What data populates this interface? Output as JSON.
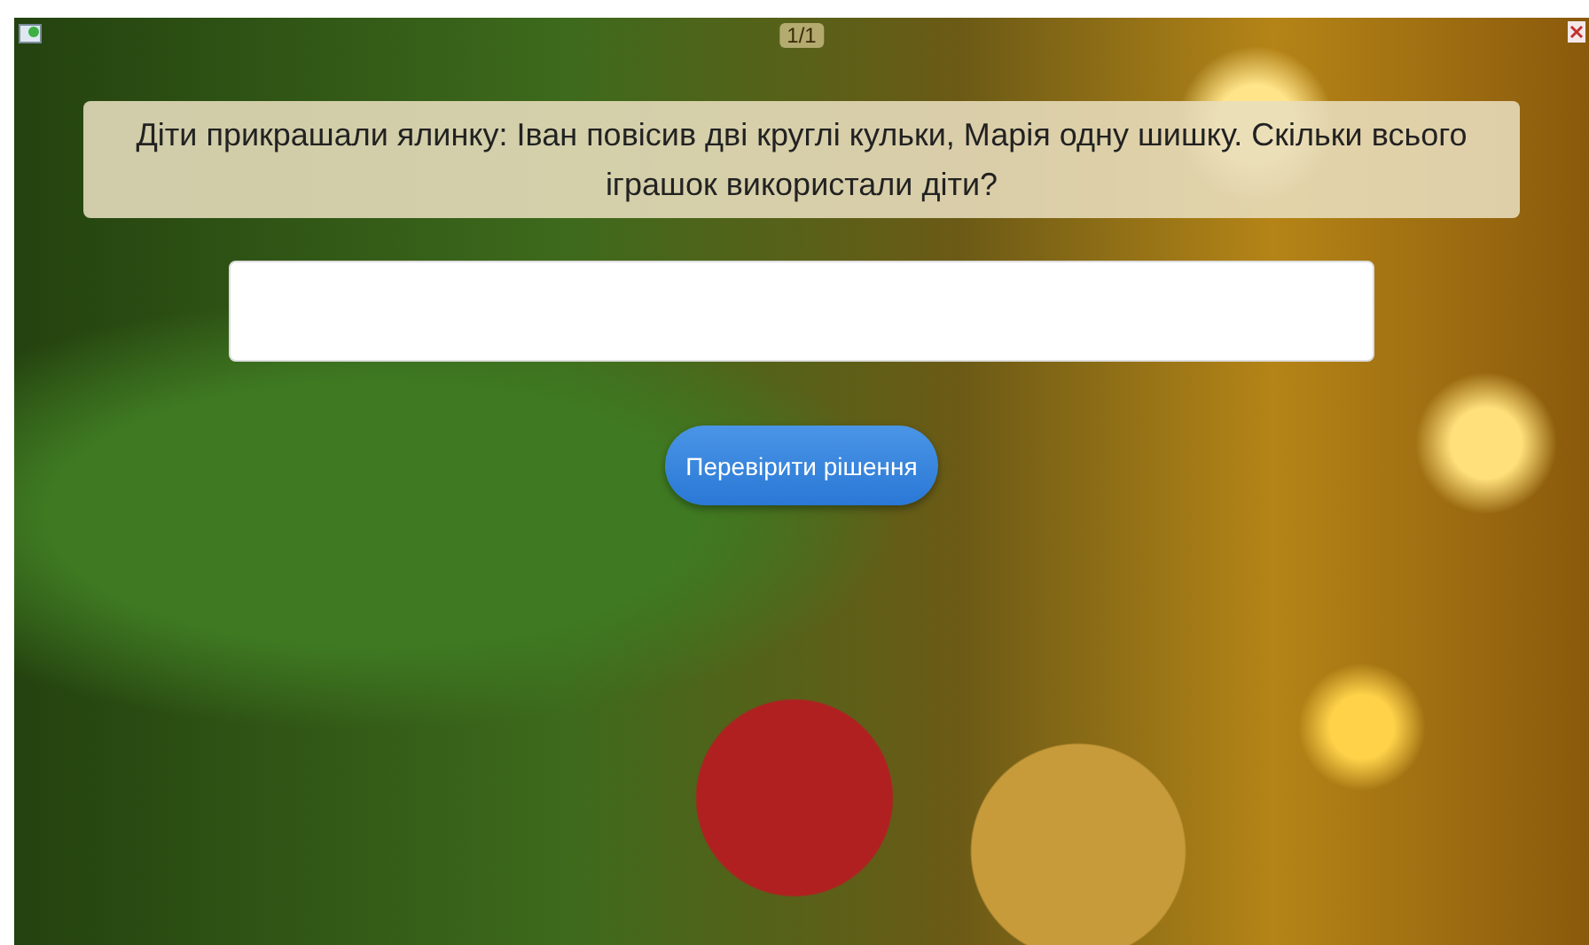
{
  "counter": "1/1",
  "question": "Діти прикрашали ялинку: Іван повісив дві круглі кульки, Марія одну шишку. Скільки всього іграшок використали діти?",
  "check_button": "Перевірити рішення"
}
